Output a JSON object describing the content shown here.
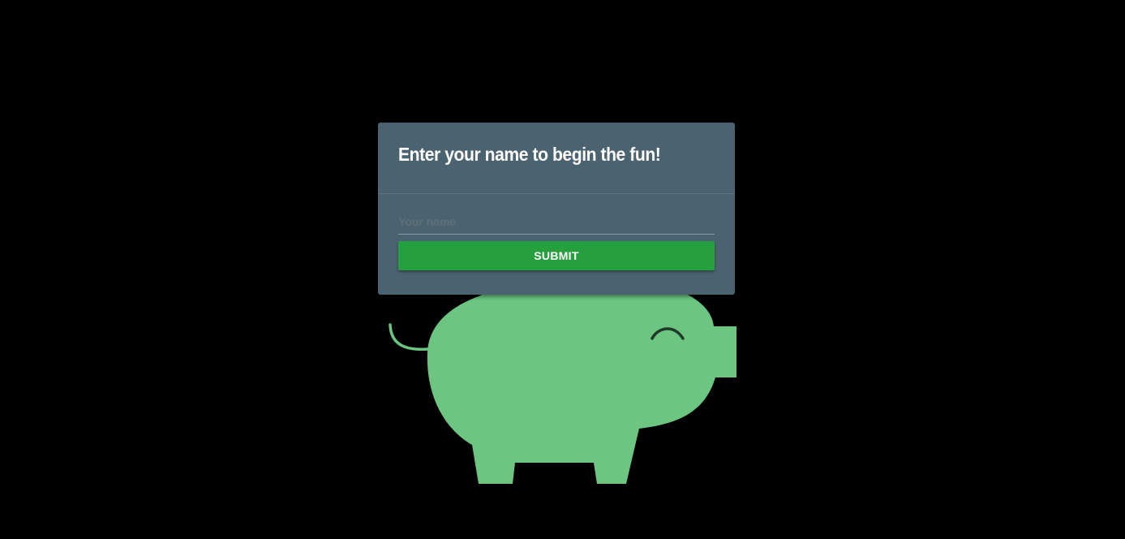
{
  "dialog": {
    "title": "Enter your name to begin the fun!",
    "name_placeholder": "Your name",
    "name_value": "",
    "submit_label": "SUBMIT"
  },
  "colors": {
    "background": "#000000",
    "dialog_background": "#4b6270",
    "submit_button": "#26a03e",
    "pig": "#6cc681"
  },
  "illustration": {
    "icon": "piggy-bank-icon"
  }
}
